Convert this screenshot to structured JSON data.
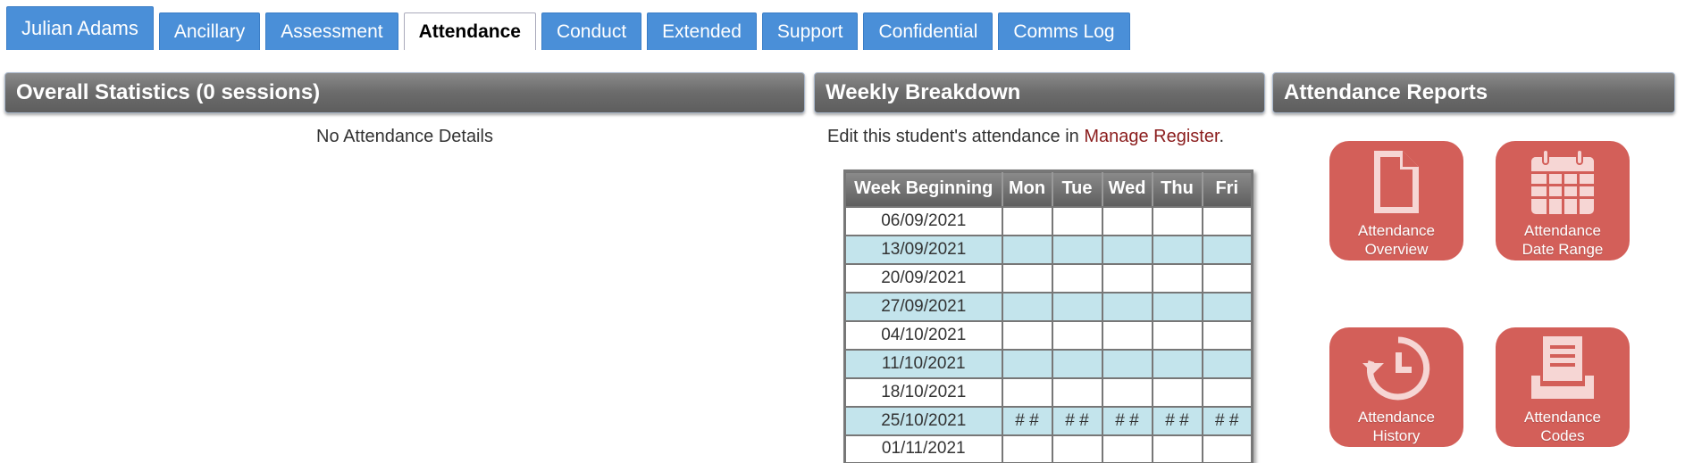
{
  "tabs": [
    {
      "label": "Julian Adams"
    },
    {
      "label": "Ancillary"
    },
    {
      "label": "Assessment"
    },
    {
      "label": "Attendance"
    },
    {
      "label": "Conduct"
    },
    {
      "label": "Extended"
    },
    {
      "label": "Support"
    },
    {
      "label": "Confidential"
    },
    {
      "label": "Comms Log"
    }
  ],
  "overall": {
    "title": "Overall Statistics (0 sessions)",
    "empty_text": "No Attendance Details"
  },
  "weekly": {
    "title": "Weekly Breakdown",
    "note_prefix": "Edit this student's attendance in ",
    "note_link": "Manage Register",
    "note_suffix": ".",
    "columns": [
      "Week Beginning",
      "Mon",
      "Tue",
      "Wed",
      "Thu",
      "Fri"
    ],
    "rows": [
      {
        "week": "06/09/2021",
        "days": [
          "",
          "",
          "",
          "",
          ""
        ]
      },
      {
        "week": "13/09/2021",
        "days": [
          "",
          "",
          "",
          "",
          ""
        ]
      },
      {
        "week": "20/09/2021",
        "days": [
          "",
          "",
          "",
          "",
          ""
        ]
      },
      {
        "week": "27/09/2021",
        "days": [
          "",
          "",
          "",
          "",
          ""
        ]
      },
      {
        "week": "04/10/2021",
        "days": [
          "",
          "",
          "",
          "",
          ""
        ]
      },
      {
        "week": "11/10/2021",
        "days": [
          "",
          "",
          "",
          "",
          ""
        ]
      },
      {
        "week": "18/10/2021",
        "days": [
          "",
          "",
          "",
          "",
          ""
        ]
      },
      {
        "week": "25/10/2021",
        "days": [
          "# #",
          "# #",
          "# #",
          "# #",
          "# #"
        ]
      },
      {
        "week": "01/11/2021",
        "days": [
          "",
          "",
          "",
          "",
          ""
        ]
      }
    ]
  },
  "reports": {
    "title": "Attendance Reports",
    "tiles": [
      {
        "line1": "Attendance",
        "line2": "Overview",
        "icon": "document-icon"
      },
      {
        "line1": "Attendance",
        "line2": "Date Range",
        "icon": "calendar-icon"
      },
      {
        "line1": "Attendance",
        "line2": "History",
        "icon": "history-icon"
      },
      {
        "line1": "Attendance",
        "line2": "Codes",
        "icon": "inbox-tray-icon"
      }
    ]
  },
  "colors": {
    "tab_blue": "#4a8fd8",
    "tile_red": "#d35f59",
    "row_alt": "#c3e4ec",
    "link": "#8b1d1d"
  }
}
